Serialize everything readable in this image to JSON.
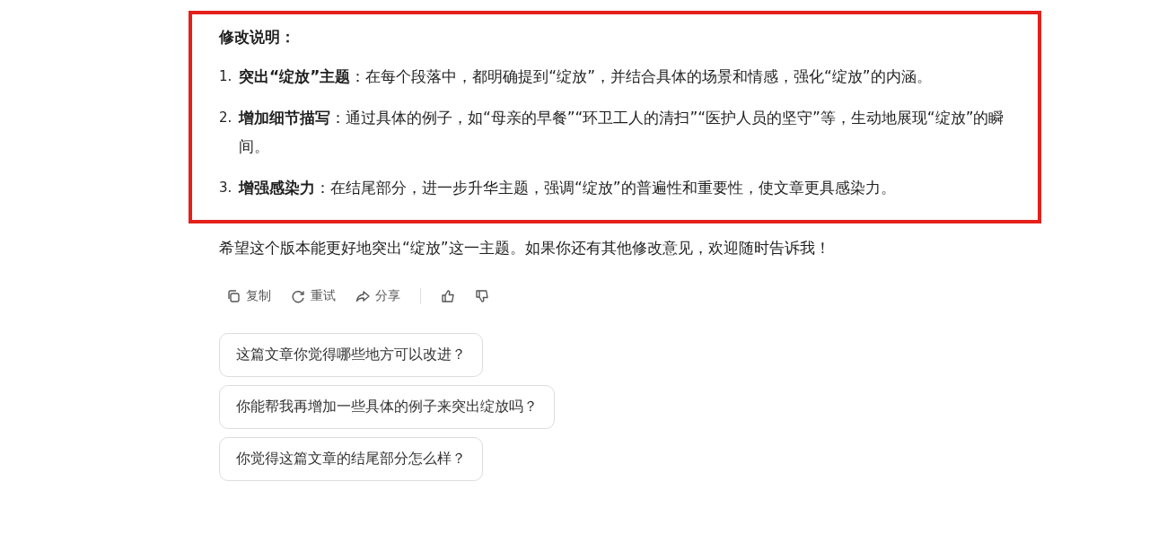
{
  "notes": {
    "heading": "修改说明：",
    "items": [
      {
        "number": "1.",
        "text": "**突出“绽放”主题**：在每个段落中，都明确提到“绽放”，并结合具体的场景和情感，强化“绽放”的内涵。"
      },
      {
        "number": "2.",
        "text": "**增加细节描写**：通过具体的例子，如“母亲的早餐”“环卫工人的清扫”“医护人员的坚守”等，生动地展现“绽放”的瞬间。"
      },
      {
        "number": "3.",
        "text": "**增强感染力**：在结尾部分，进一步升华主题，强调“绽放”的普遍性和重要性，使文章更具感染力。"
      }
    ]
  },
  "closing": "希望这个版本能更好地突出“绽放”这一主题。如果你还有其他修改意见，欢迎随时告诉我！",
  "actions": [
    {
      "kind": "copy",
      "label": "复制"
    },
    {
      "kind": "retry",
      "label": "重试"
    },
    {
      "kind": "share",
      "label": "分享"
    },
    {
      "kind": "like"
    },
    {
      "kind": "dislike"
    }
  ],
  "suggestions": [
    "这篇文章你觉得哪些地方可以改进？",
    "你能帮我再增加一些具体的例子来突出绽放吗？",
    "你觉得这篇文章的结尾部分怎么样？"
  ]
}
